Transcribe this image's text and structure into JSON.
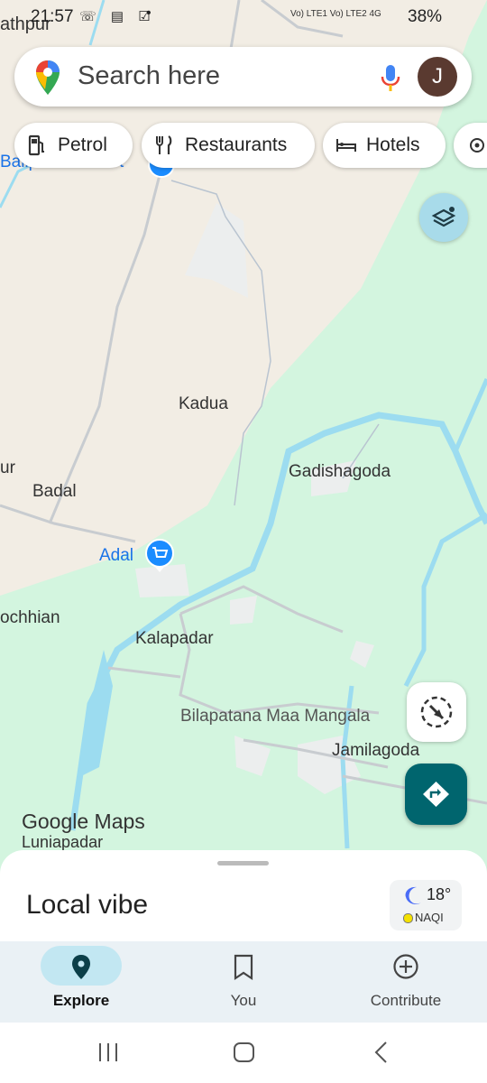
{
  "status": {
    "time": "21:57",
    "left_icons": "☏ ▤ ☑",
    "network": "Vo) LTE1 Vo) LTE2 4G",
    "battery": "38%"
  },
  "search": {
    "placeholder": "Search here",
    "avatar_letter": "J"
  },
  "chips": [
    {
      "label": "Petrol",
      "icon": "fuel-icon"
    },
    {
      "label": "Restaurants",
      "icon": "fork-knife-icon"
    },
    {
      "label": "Hotels",
      "icon": "bed-icon"
    }
  ],
  "map_labels": {
    "athpur": "athpur",
    "balipada": "Balipada Market",
    "kadua": "Kadua",
    "ur": "ur",
    "badal": "Badal",
    "adal": "Adal",
    "gadishagoda": "Gadishagoda",
    "kochhian": "ochhian",
    "kalapadar": "Kalapadar",
    "bilapatana": "Bilapatana Maa Mangala",
    "jamilagoda": "Jamilagoda",
    "luniapadar": "Luniapadar"
  },
  "google_logo": "Google Maps",
  "sheet": {
    "title": "Local vibe",
    "temperature": "18°",
    "aqi": "NAQI"
  },
  "nav": [
    {
      "label": "Explore",
      "icon": "location-pin-icon",
      "active": true
    },
    {
      "label": "You",
      "icon": "bookmark-icon",
      "active": false
    },
    {
      "label": "Contribute",
      "icon": "add-circle-icon",
      "active": false
    }
  ],
  "colors": {
    "land": "#f2ede4",
    "forest": "#d3f5df",
    "water": "#9cdcf0",
    "accent": "#00656e",
    "nav_bg": "#eaf1f5",
    "nav_active": "#c2e7f2"
  }
}
